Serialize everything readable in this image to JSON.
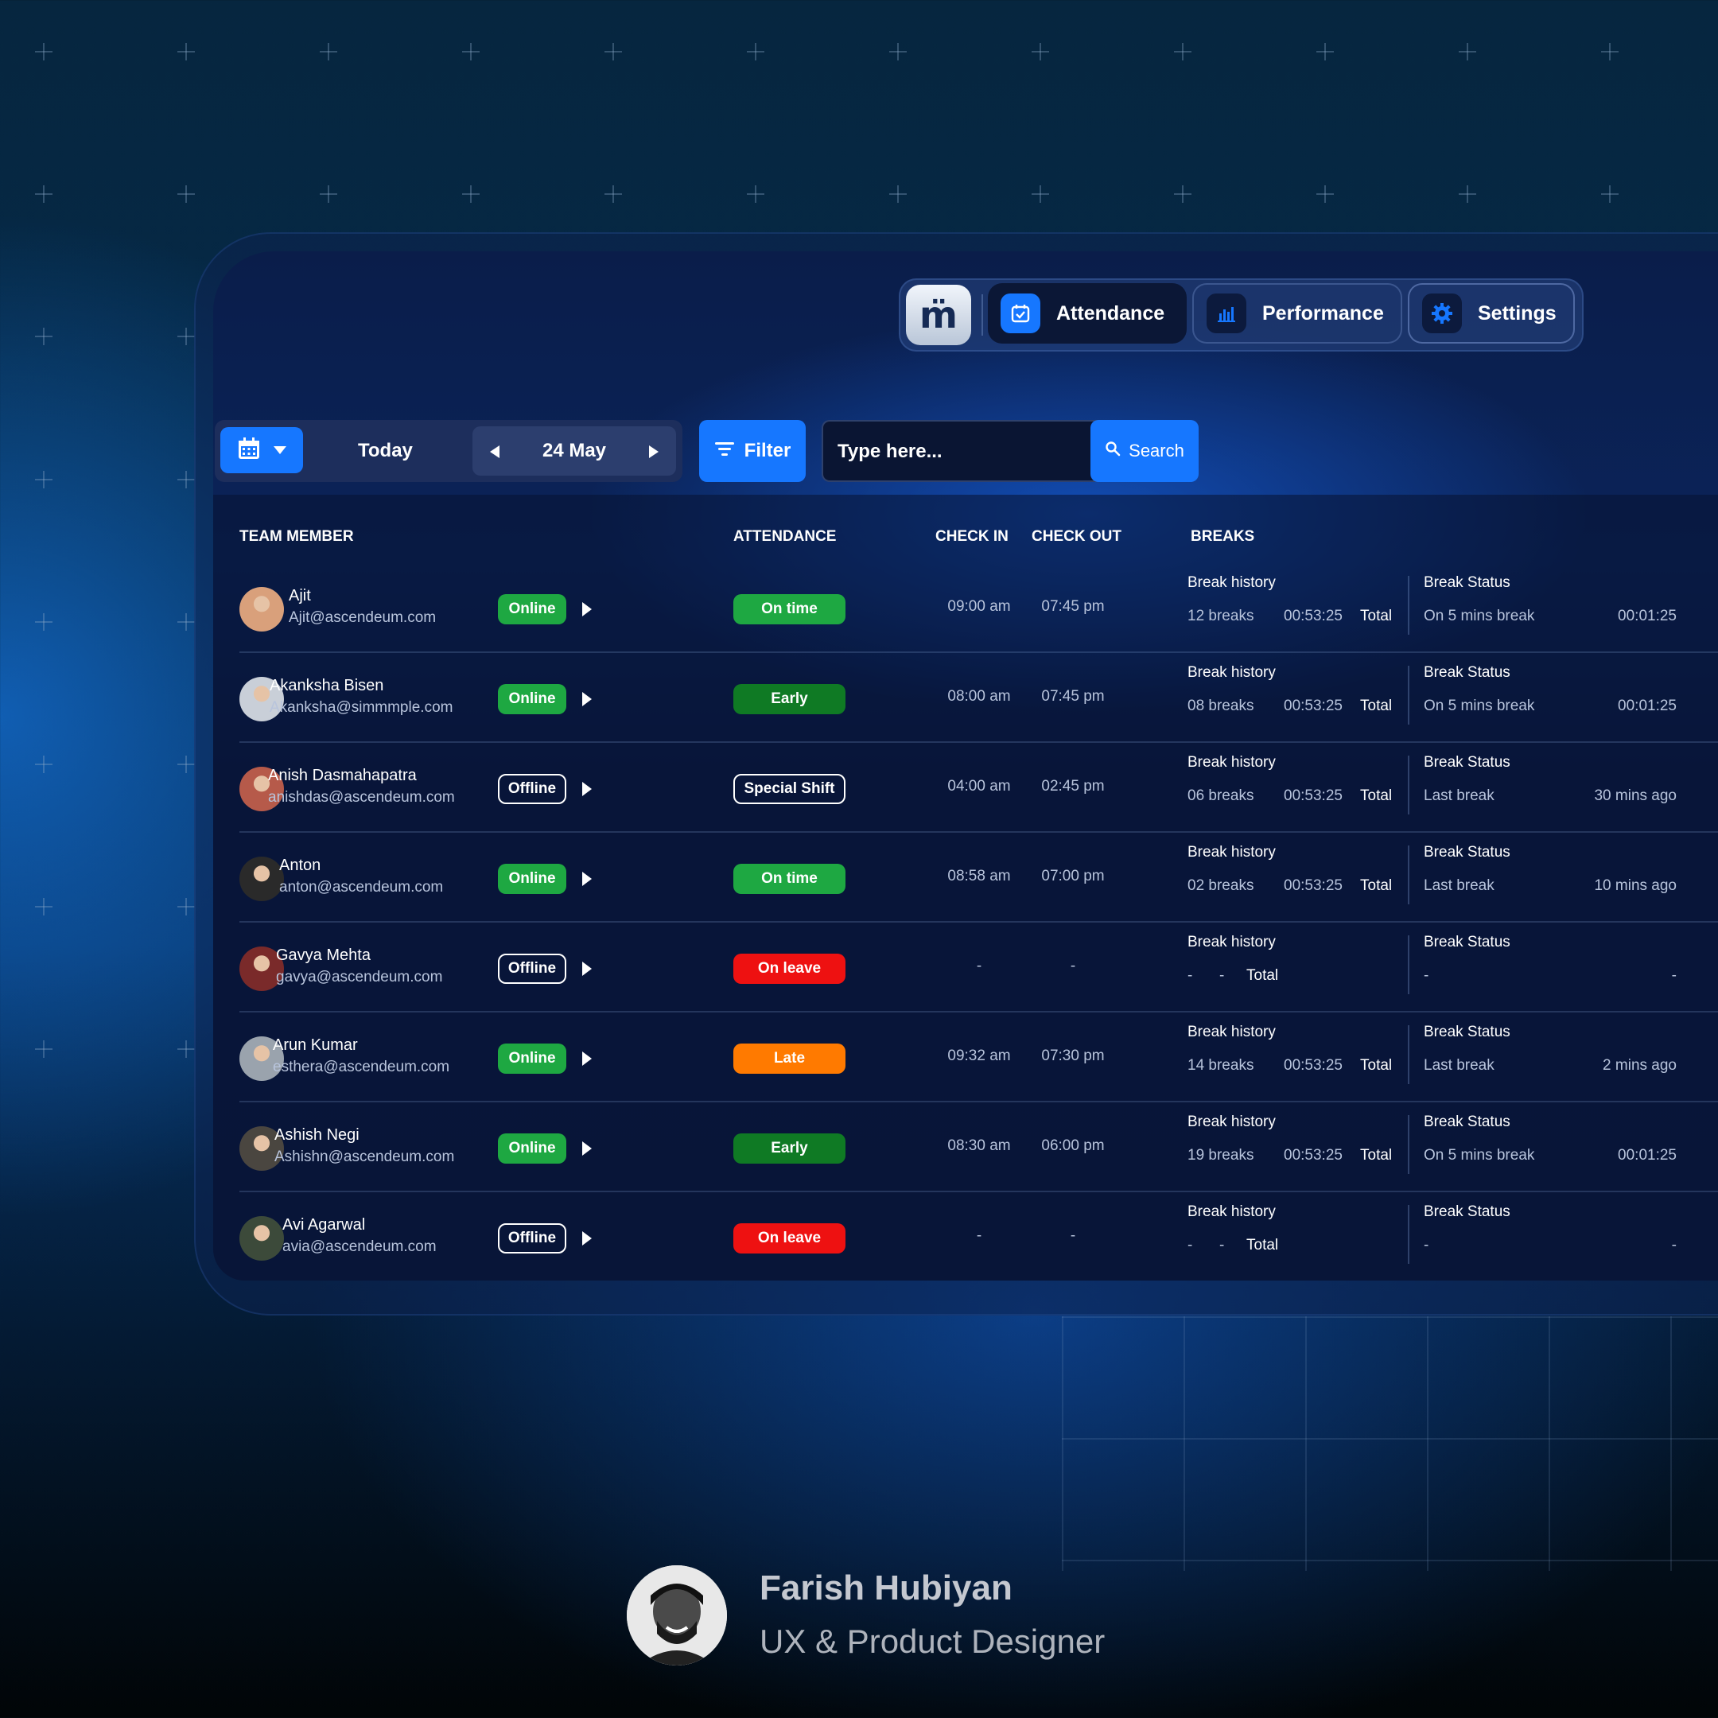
{
  "nav": {
    "logo": "m̈",
    "items": [
      {
        "label": "Attendance",
        "icon": "calendar-check-icon"
      },
      {
        "label": "Performance",
        "icon": "bar-chart-icon"
      },
      {
        "label": "Settings",
        "icon": "gear-icon"
      }
    ]
  },
  "toolbar": {
    "today_label": "Today",
    "date_label": "24 May",
    "filter_label": "Filter",
    "search_placeholder": "Type here...",
    "search_label": "Search"
  },
  "table": {
    "headers": {
      "member": "TEAM MEMBER",
      "attendance": "ATTENDANCE",
      "check_in": "CHECK IN",
      "check_out": "CHECK OUT",
      "breaks": "BREAKS"
    },
    "break_history_label": "Break history",
    "break_status_label": "Break Status",
    "total_label": "Total",
    "rows": [
      {
        "name": "Ajit",
        "email": "Ajit@ascendeum.com",
        "status": "Online",
        "attendance": "On time",
        "attendance_color": "#1ea842",
        "check_in": "09:00 am",
        "check_out": "07:45 pm",
        "breaks": "12 breaks",
        "break_duration": "00:53:25",
        "break_status": "On 5 mins break",
        "break_status_value": "00:01:25"
      },
      {
        "name": "Akanksha Bisen",
        "email": "Akanksha@simmmple.com",
        "status": "Online",
        "attendance": "Early",
        "attendance_color": "#0f7a24",
        "check_in": "08:00 am",
        "check_out": "07:45 pm",
        "breaks": "08 breaks",
        "break_duration": "00:53:25",
        "break_status": "On 5 mins break",
        "break_status_value": "00:01:25"
      },
      {
        "name": "Anish Dasmahapatra",
        "email": "anishdas@ascendeum.com",
        "status": "Offline",
        "attendance": "Special Shift",
        "attendance_color": "outline",
        "check_in": "04:00 am",
        "check_out": "02:45 pm",
        "breaks": "06 breaks",
        "break_duration": "00:53:25",
        "break_status": "Last break",
        "break_status_value": "30 mins ago"
      },
      {
        "name": "Anton",
        "email": "anton@ascendeum.com",
        "status": "Online",
        "attendance": "On time",
        "attendance_color": "#1ea842",
        "check_in": "08:58 am",
        "check_out": "07:00 pm",
        "breaks": "02 breaks",
        "break_duration": "00:53:25",
        "break_status": "Last break",
        "break_status_value": "10 mins ago"
      },
      {
        "name": "Gavya Mehta",
        "email": "gavya@ascendeum.com",
        "status": "Offline",
        "attendance": "On leave",
        "attendance_color": "#ee1111",
        "check_in": "-",
        "check_out": "-",
        "breaks": "-",
        "break_duration": "-",
        "break_status": "-",
        "break_status_value": "-"
      },
      {
        "name": "Arun Kumar",
        "email": "esthera@ascendeum.com",
        "status": "Online",
        "attendance": "Late",
        "attendance_color": "#ff7a00",
        "check_in": "09:32 am",
        "check_out": "07:30 pm",
        "breaks": "14 breaks",
        "break_duration": "00:53:25",
        "break_status": "Last break",
        "break_status_value": "2 mins ago"
      },
      {
        "name": "Ashish Negi",
        "email": "Ashishn@ascendeum.com",
        "status": "Online",
        "attendance": "Early",
        "attendance_color": "#0f7a24",
        "check_in": "08:30 am",
        "check_out": "06:00 pm",
        "breaks": "19 breaks",
        "break_duration": "00:53:25",
        "break_status": "On 5 mins break",
        "break_status_value": "00:01:25"
      },
      {
        "name": "Avi Agarwal",
        "email": "avia@ascendeum.com",
        "status": "Offline",
        "attendance": "On leave",
        "attendance_color": "#ee1111",
        "check_in": "-",
        "check_out": "-",
        "breaks": "-",
        "break_duration": "-",
        "break_status": "-",
        "break_status_value": "-"
      }
    ]
  },
  "author": {
    "name": "Farish Hubiyan",
    "role": "UX & Product Designer"
  },
  "colors": {
    "accent": "#1677ff",
    "online": "#1ea842"
  }
}
